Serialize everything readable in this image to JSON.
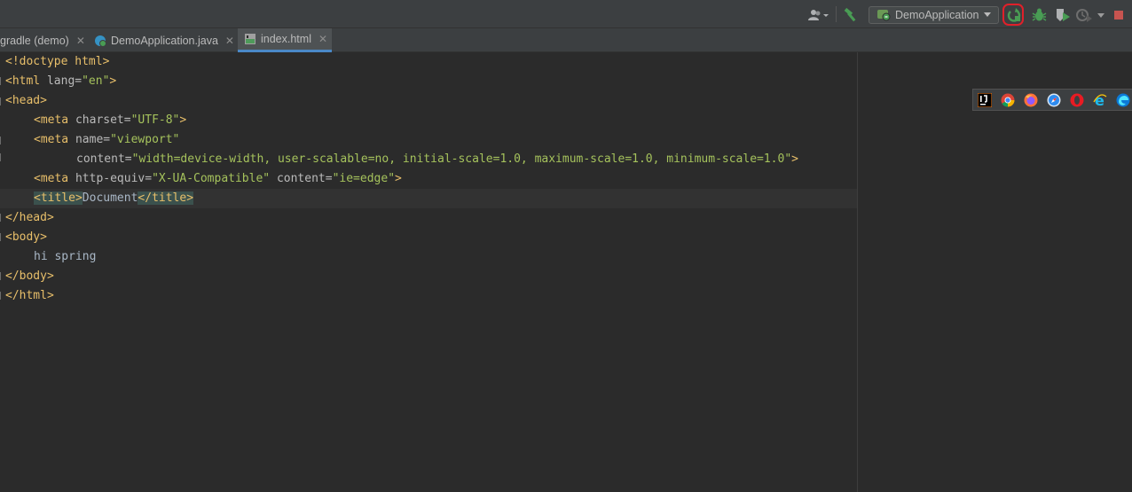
{
  "toolbar": {
    "run_config_label": "DemoApplication",
    "icons": [
      "user-icon",
      "build-hammer-icon",
      "spring-boot-icon",
      "rerun-icon",
      "debug-icon",
      "run-with-coverage-icon",
      "profile-icon",
      "stop-icon"
    ],
    "accent_green": "#499c54",
    "stop_color": "#c75450",
    "highlight_color": "#e0202a"
  },
  "tabs": [
    {
      "label": "gradle (demo)",
      "icon": "gradle-icon",
      "active": false
    },
    {
      "label": "DemoApplication.java",
      "icon": "java-class-icon",
      "active": false
    },
    {
      "label": "index.html",
      "icon": "html-file-icon",
      "active": true
    }
  ],
  "editor": {
    "lines": {
      "l1": {
        "tag_open": "<!doctype ",
        "word": "html",
        "tag_close": ">"
      },
      "l2": {
        "tag_open": "<html ",
        "attr": "lang=",
        "val": "\"en\"",
        "tag_close": ">"
      },
      "l3": {
        "tag": "<head>"
      },
      "l4": {
        "tag_open": "<meta ",
        "attr": "charset=",
        "val": "\"UTF-8\"",
        "tag_close": ">"
      },
      "l5": {
        "tag_open": "<meta ",
        "attr": "name=",
        "val": "\"viewport\""
      },
      "l6": {
        "attr": "content=",
        "val": "\"width=device-width, user-scalable=no, initial-scale=1.0, maximum-scale=1.0, minimum-scale=1.0\"",
        "tag_close": ">"
      },
      "l7": {
        "tag_open": "<meta ",
        "attr1": "http-equiv=",
        "val1": "\"X-UA-Compatible\"",
        "attr2": " content=",
        "val2": "\"ie=edge\"",
        "tag_close": ">"
      },
      "l8": {
        "tag_open": "<title>",
        "text": "Document",
        "tag_close": "</title>"
      },
      "l9": {
        "tag": "</head>"
      },
      "l10": {
        "tag": "<body>"
      },
      "l11": {
        "text": "hi spring"
      },
      "l12": {
        "tag": "</body>"
      },
      "l13": {
        "tag": "</html>"
      }
    },
    "colors": {
      "tag": "#e8bf6a",
      "attr": "#bababa",
      "value": "#a5c25c",
      "text": "#a9b7c6",
      "background": "#2b2b2b"
    }
  },
  "browser_popup": {
    "icons": [
      "intellij-icon",
      "chrome-icon",
      "firefox-icon",
      "safari-icon",
      "opera-icon",
      "internet-explorer-icon",
      "edge-icon"
    ]
  }
}
